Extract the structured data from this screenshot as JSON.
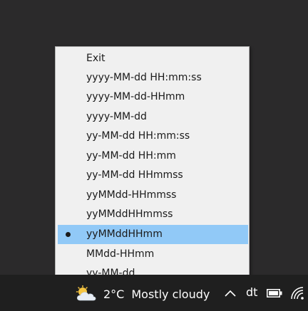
{
  "menu": {
    "items": [
      {
        "label": "Exit",
        "selected": false
      },
      {
        "label": "yyyy-MM-dd HH:mm:ss",
        "selected": false
      },
      {
        "label": "yyyy-MM-dd-HHmm",
        "selected": false
      },
      {
        "label": "yyyy-MM-dd",
        "selected": false
      },
      {
        "label": "yy-MM-dd HH:mm:ss",
        "selected": false
      },
      {
        "label": "yy-MM-dd HH:mm",
        "selected": false
      },
      {
        "label": "yy-MM-dd HHmmss",
        "selected": false
      },
      {
        "label": "yyMMdd-HHmmss",
        "selected": false
      },
      {
        "label": "yyMMddHHmmss",
        "selected": false
      },
      {
        "label": "yyMMddHHmm",
        "selected": true
      },
      {
        "label": "MMdd-HHmm",
        "selected": false
      },
      {
        "label": "yy-MM-dd",
        "selected": false
      }
    ]
  },
  "taskbar": {
    "weather": {
      "temperature": "2°C",
      "condition": "Mostly cloudy",
      "icon": "partly-cloudy-icon"
    },
    "tray_app_label": "dt",
    "icons": [
      "chevron-up-icon",
      "battery-icon",
      "wifi-icon"
    ]
  },
  "colors": {
    "desktop": "#2b2a2b",
    "taskbar": "#1f1f1f",
    "menu_bg": "#f0f0f0",
    "selected_bg": "#91c9f7"
  }
}
